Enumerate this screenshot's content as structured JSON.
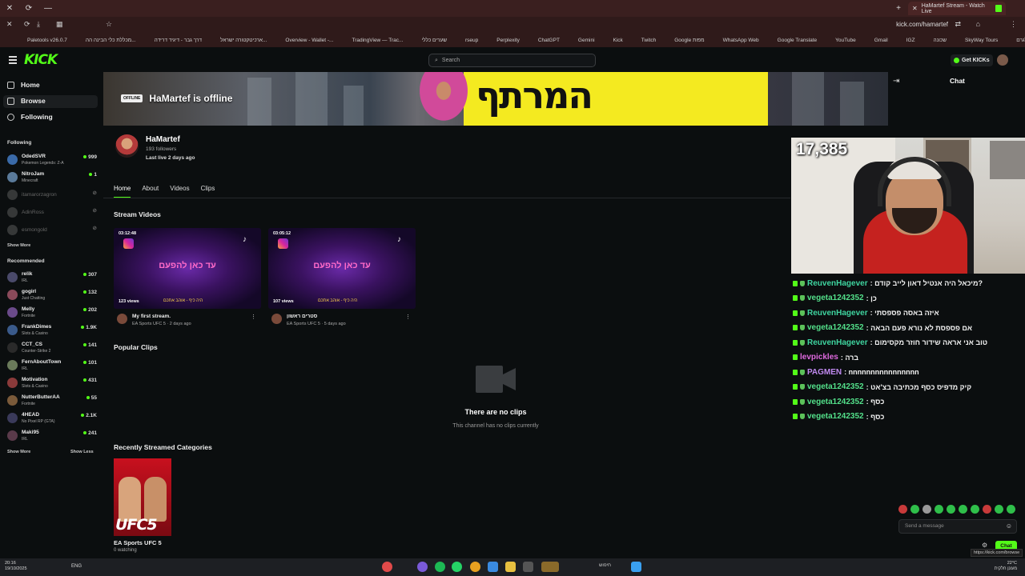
{
  "browser": {
    "tab_title": "HaMartef Stream - Watch Live",
    "url": "kick.com/hamartef",
    "bookmarks": [
      "Paletools v26.0.7",
      "מכללת כלי הבינה הה...",
      "דרך גבר - דיגיד דרידה",
      "ארכיטקטורה ישראל...",
      "Overview - Wallet -...",
      "TradingView — Trac...",
      "שערים כללי",
      "rseup",
      "Perplexity",
      "ChatGPT",
      "Gemini",
      "Kick",
      "Twitch",
      "Google מפות",
      "WhatsApp Web",
      "Google Translate",
      "YouTube",
      "Gmail",
      "IGZ",
      "שכונה",
      "SkyWay Tours",
      "מורדת מדוגמא לטלגרם"
    ]
  },
  "header": {
    "logo": "KICK",
    "search_placeholder": "Search",
    "get_kicks": "Get KICKs"
  },
  "sidebar": {
    "nav": [
      {
        "label": "Home",
        "icon": "home-icon"
      },
      {
        "label": "Browse",
        "icon": "browse-icon"
      },
      {
        "label": "Following",
        "icon": "heart-icon"
      }
    ],
    "following_title": "Following",
    "following": [
      {
        "name": "OdedSVR",
        "game": "Pokemon Legends: Z-A",
        "viewers": "999",
        "color": "#3a6aa8",
        "live": true
      },
      {
        "name": "NitroJam",
        "game": "Minecraft",
        "viewers": "1",
        "color": "#5a7a9a",
        "live": true
      },
      {
        "name": "itamarorzagron",
        "game": "",
        "viewers": "",
        "color": "#888888",
        "live": false
      },
      {
        "name": "AdinRoss",
        "game": "",
        "viewers": "",
        "color": "#888888",
        "live": false
      },
      {
        "name": "esmongold",
        "game": "",
        "viewers": "",
        "color": "#888888",
        "live": false
      }
    ],
    "show_more": "Show More",
    "recommended_title": "Recommended",
    "recommended": [
      {
        "name": "relik",
        "game": "IRL",
        "viewers": "307",
        "color": "#4a4a6a"
      },
      {
        "name": "gogirl",
        "game": "Just Chatting",
        "viewers": "132",
        "color": "#8a4a5a"
      },
      {
        "name": "Melly",
        "game": "Fortnite",
        "viewers": "202",
        "color": "#6a4a8a"
      },
      {
        "name": "FrankDimes",
        "game": "Slots & Casino",
        "viewers": "1.9K",
        "color": "#3a5a8a"
      },
      {
        "name": "CCT_CS",
        "game": "Counter-Strike 2",
        "viewers": "141",
        "color": "#2a2a2a"
      },
      {
        "name": "FernAboutTown",
        "game": "IRL",
        "viewers": "101",
        "color": "#6a7a5a"
      },
      {
        "name": "Motivation",
        "game": "Slots & Casino",
        "viewers": "431",
        "color": "#8a3a3a"
      },
      {
        "name": "NutterButterAA",
        "game": "Fortnite",
        "viewers": "55",
        "color": "#7a5a3a"
      },
      {
        "name": "4HEAD",
        "game": "No Pixel RP (GTA)",
        "viewers": "2.1K",
        "color": "#3a3a5a"
      },
      {
        "name": "Maki95",
        "game": "IRL",
        "viewers": "241",
        "color": "#5a3a4a"
      }
    ],
    "show_more_2": "Show More",
    "show_less": "Show Less"
  },
  "banner": {
    "offline_tag": "OFFLINE",
    "offline_text": "HaMartef is offline",
    "hebrew_title": "המרתף"
  },
  "channel": {
    "name": "HaMartef",
    "followers": "193 followers",
    "last_live": "Last live 2 days ago",
    "tabs": [
      "Home",
      "About",
      "Videos",
      "Clips"
    ]
  },
  "stream_videos": {
    "title": "Stream Videos",
    "items": [
      {
        "duration": "03:12:48",
        "views": "123 views",
        "title": "My first stream.",
        "subtitle": "EA Sports UFC 5 · 2 days ago",
        "thumb_text": "עד כאן להפעם",
        "bottom_text": "היה כיף - אוהב אתכם"
      },
      {
        "duration": "03:05:12",
        "views": "107 views",
        "title": "סטרים ראשון",
        "subtitle": "EA Sports UFC 5 · 5 days ago",
        "thumb_text": "עד כאן להפעם",
        "bottom_text": "היה כיף - אוהב אתכם"
      }
    ]
  },
  "popular_clips": {
    "title": "Popular Clips",
    "empty_title": "There are no clips",
    "empty_sub": "This channel has no clips currently"
  },
  "categories": {
    "title": "Recently Streamed Categories",
    "items": [
      {
        "name": "EA Sports UFC 5",
        "watching": "0 watching",
        "logo": "UFC5"
      }
    ]
  },
  "chat": {
    "title": "Chat",
    "viewer_overlay": "17,385",
    "messages": [
      {
        "user": "ReuvenHagever",
        "color": "#3fd5a0",
        "text": ": מיכאל היה אנטיל דאון לייב קודם?"
      },
      {
        "user": "vegeta1242352",
        "color": "#53e08a",
        "text": ": כן"
      },
      {
        "user": "ReuvenHagever",
        "color": "#3fd5a0",
        "text": ": איזה באסה פספסתי"
      },
      {
        "user": "vegeta1242352",
        "color": "#53e08a",
        "text": ": אם פספסת לא נורא פעם הבאה"
      },
      {
        "user": "ReuvenHagever",
        "color": "#3fd5a0",
        "text": ": טוב אני אראה שידור חוזר מקסימום"
      },
      {
        "user": "levpickles",
        "color": "#e06ae0",
        "text": ": ברה"
      },
      {
        "user": "PAGMEN",
        "color": "#c08af0",
        "text": ": nnnnnnnnnnnnnnnn"
      },
      {
        "user": "vegeta1242352",
        "color": "#53e08a",
        "text": ": קיק מדפיס כסף מכתיבה בצ'אט"
      },
      {
        "user": "vegeta1242352",
        "color": "#53e08a",
        "text": ": כסף"
      },
      {
        "user": "vegeta1242352",
        "color": "#53e08a",
        "text": ": כסף"
      }
    ],
    "input_placeholder": "Send a message",
    "send_label": "Chat",
    "status_url": "https://kick.com/browse"
  },
  "taskbar": {
    "time": "20:16",
    "date": "19/10/2025",
    "lang": "ENG",
    "search": "חיפוש",
    "weather": "22°C",
    "weather_desc": "מעונן חלקית"
  }
}
